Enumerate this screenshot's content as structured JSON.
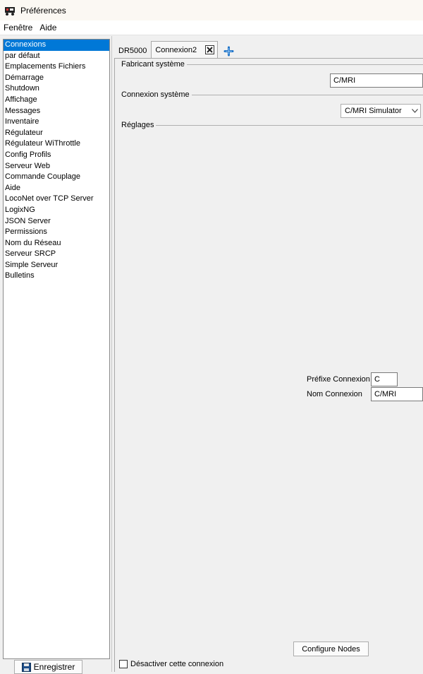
{
  "window": {
    "title": "Préférences"
  },
  "menu": {
    "items": [
      "Fenêtre",
      "Aide"
    ]
  },
  "sidebar": {
    "items": [
      "Connexions",
      "par défaut",
      "Emplacements Fichiers",
      "Démarrage",
      "Shutdown",
      "Affichage",
      "Messages",
      "Inventaire",
      "Régulateur",
      "Régulateur WiThrottle",
      "Config Profils",
      "Serveur Web",
      "Commande Couplage",
      "Aide",
      "LocoNet over TCP Server",
      "LogixNG",
      "JSON Server",
      "Permissions",
      "Nom du Réseau",
      "Serveur SRCP",
      "Simple Serveur",
      "Bulletins"
    ],
    "selected": "Connexions",
    "save_label": "Enregistrer"
  },
  "tabs": {
    "items": [
      {
        "label": "DR5000",
        "active": false
      },
      {
        "label": "Connexion2",
        "active": true
      }
    ]
  },
  "connection": {
    "manufacturer_label": "Fabricant système",
    "manufacturer_value": "C/MRI",
    "system_label": "Connexion système",
    "system_value": "C/MRI Simulator",
    "settings_label": "Réglages",
    "prefix_label": "Préfixe Connexion",
    "prefix_value": "C",
    "name_label": "Nom Connexion",
    "name_value": "C/MRI",
    "configure_label": "Configure Nodes",
    "disable_label": "Désactiver cette connexion"
  },
  "colors": {
    "selection": "#0078d7",
    "add_icon": "#1e73c8"
  }
}
